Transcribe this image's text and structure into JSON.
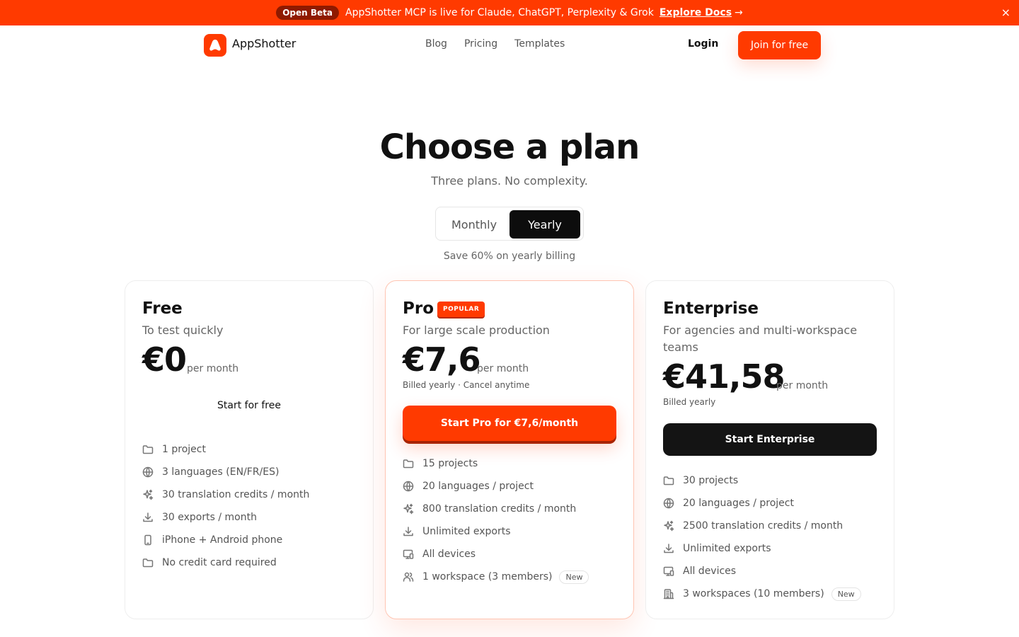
{
  "banner": {
    "pill": "Open Beta",
    "message": "AppShotter MCP is live for Claude, ChatGPT, Perplexity & Grok",
    "link": "Explore Docs",
    "arrow": "→",
    "close": "×"
  },
  "nav": {
    "brand": "AppShotter",
    "links": [
      "Blog",
      "Pricing",
      "Templates"
    ],
    "login": "Login",
    "cta": "Join for free"
  },
  "hero": {
    "title": "Choose a plan",
    "subtitle": "Three plans. No complexity.",
    "toggle": {
      "monthly": "Monthly",
      "yearly": "Yearly",
      "selected": "Yearly"
    },
    "save_note": "Save 60% on yearly billing"
  },
  "colors": {
    "accent": "#ff3a00",
    "dark": "#141414"
  },
  "plans": [
    {
      "name": "Free",
      "description": "To test quickly",
      "price": "€0",
      "period": "per month",
      "cta": "Start for free",
      "features": [
        {
          "icon": "folder-icon",
          "text": "1 project"
        },
        {
          "icon": "globe-icon",
          "text": "3 languages (EN/FR/ES)"
        },
        {
          "icon": "sparkles-icon",
          "text": "30 translation credits / month"
        },
        {
          "icon": "download-icon",
          "text": "30 exports / month"
        },
        {
          "icon": "phone-icon",
          "text": "iPhone + Android phone"
        },
        {
          "icon": "folder-icon",
          "text": "No credit card required"
        }
      ]
    },
    {
      "name": "Pro",
      "badge": "POPULAR",
      "description": "For large scale production",
      "price": "€7,6",
      "period": "per month",
      "billed": "Billed yearly · Cancel anytime",
      "cta": "Start Pro for €7,6/month",
      "features": [
        {
          "icon": "folder-icon",
          "text": "15 projects"
        },
        {
          "icon": "globe-icon",
          "text": "20 languages / project"
        },
        {
          "icon": "sparkles-icon",
          "text": "800 translation credits / month"
        },
        {
          "icon": "download-icon",
          "text": "Unlimited exports"
        },
        {
          "icon": "devices-icon",
          "text": "All devices"
        },
        {
          "icon": "users-icon",
          "text": "1 workspace (3 members)",
          "badge": "New"
        }
      ]
    },
    {
      "name": "Enterprise",
      "description": "For agencies and multi-workspace teams",
      "price": "€41,58",
      "period": "per month",
      "billed": "Billed yearly",
      "cta": "Start Enterprise",
      "features": [
        {
          "icon": "folder-icon",
          "text": "30 projects"
        },
        {
          "icon": "globe-icon",
          "text": "20 languages / project"
        },
        {
          "icon": "sparkles-icon",
          "text": "2500 translation credits / month"
        },
        {
          "icon": "download-icon",
          "text": "Unlimited exports"
        },
        {
          "icon": "devices-icon",
          "text": "All devices"
        },
        {
          "icon": "building-icon",
          "text": "3 workspaces (10 members)",
          "badge": "New"
        }
      ]
    }
  ]
}
